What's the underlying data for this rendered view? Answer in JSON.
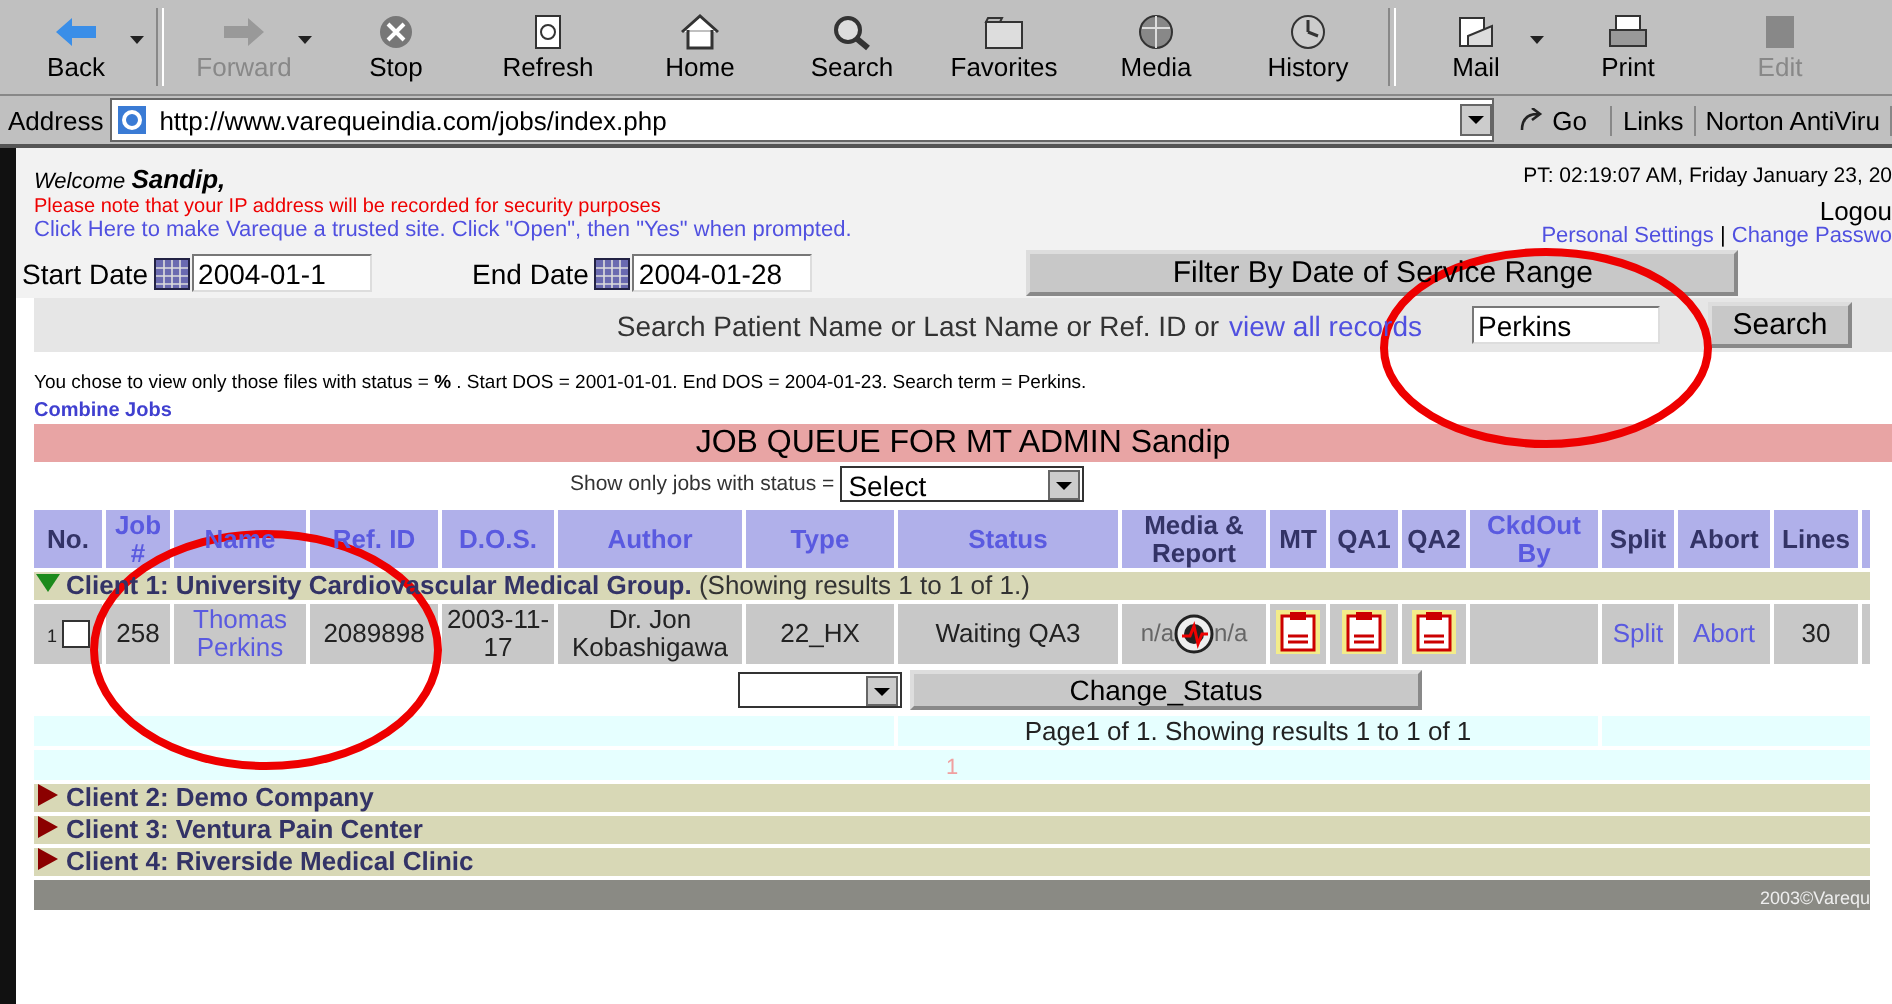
{
  "toolbar": {
    "buttons": [
      {
        "label": "Back",
        "disabled": false,
        "menu": true
      },
      {
        "label": "Forward",
        "disabled": true,
        "menu": true
      },
      {
        "label": "Stop",
        "disabled": false,
        "menu": false
      },
      {
        "label": "Refresh",
        "disabled": false,
        "menu": false
      },
      {
        "label": "Home",
        "disabled": false,
        "menu": false
      },
      {
        "label": "Search",
        "disabled": false,
        "menu": false
      },
      {
        "label": "Favorites",
        "disabled": false,
        "menu": false
      },
      {
        "label": "Media",
        "disabled": false,
        "menu": false
      },
      {
        "label": "History",
        "disabled": false,
        "menu": false
      },
      {
        "label": "Mail",
        "disabled": false,
        "menu": true
      },
      {
        "label": "Print",
        "disabled": false,
        "menu": false
      },
      {
        "label": "Edit",
        "disabled": true,
        "menu": false
      }
    ]
  },
  "address_bar": {
    "label": "Address",
    "url": "http://www.varequeindia.com/jobs/index.php",
    "go": "Go",
    "links": "Links",
    "norton": "Norton AntiViru"
  },
  "header": {
    "welcome": "Welcome",
    "user": "Sandip,",
    "timestamp": "PT: 02:19:07 AM, Friday January 23, 20",
    "notice": "Please note that your IP address will be recorded for security purposes",
    "trusted_link": "Click Here to make Vareque a trusted site. Click \"Open\", then \"Yes\" when prompted.",
    "logout": "Logou",
    "personal_settings": "Personal Settings",
    "separator": "|",
    "change_password": "Change Passwo"
  },
  "filters": {
    "start_label": "Start Date",
    "start_value": "2004-01-1",
    "end_label": "End Date",
    "end_value": "2004-01-28",
    "filter_button": "Filter By Date of Service Range",
    "search_label": "Search Patient Name or Last Name or Ref. ID or",
    "view_all": "view all records",
    "search_value": "Perkins",
    "search_button": "Search"
  },
  "summary": "You chose to view only those files with status = **%** . Start DOS = 2001-01-01. End DOS = 2004-01-23. Search term = Perkins.",
  "combine_jobs": "Combine Jobs",
  "queue": {
    "title": "JOB QUEUE FOR MT ADMIN Sandip",
    "status_filter_label": "Show only jobs with status =",
    "status_filter_value": "Select",
    "columns": [
      {
        "label": "No.",
        "sortable": false
      },
      {
        "label": "Job #",
        "sortable": true
      },
      {
        "label": "Name",
        "sortable": true
      },
      {
        "label": "Ref. ID",
        "sortable": true
      },
      {
        "label": "D.O.S.",
        "sortable": true
      },
      {
        "label": "Author",
        "sortable": true
      },
      {
        "label": "Type",
        "sortable": true
      },
      {
        "label": "Status",
        "sortable": true
      },
      {
        "label": "Media & Report",
        "sortable": false
      },
      {
        "label": "MT",
        "sortable": false
      },
      {
        "label": "QA1",
        "sortable": false
      },
      {
        "label": "QA2",
        "sortable": false
      },
      {
        "label": "CkdOut By",
        "sortable": true
      },
      {
        "label": "Split",
        "sortable": false
      },
      {
        "label": "Abort",
        "sortable": false
      },
      {
        "label": "Lines",
        "sortable": false
      }
    ],
    "groups": [
      {
        "label": "Client 1: University Cardiovascular Medical Group.",
        "note": "(Showing results 1 to 1 of 1.)",
        "expanded": true,
        "rows": [
          {
            "no": "1",
            "checked": false,
            "job": "258",
            "name": "Thomas Perkins",
            "ref_id": "2089898",
            "dos": "2003-11-17",
            "author": "Dr. Jon Kobashigawa",
            "type": "22_HX",
            "status": "Waiting QA3",
            "media_left": "n/a",
            "media_right": "n/a",
            "split": "Split",
            "abort": "Abort",
            "lines": "30"
          }
        ],
        "change_status_button": "Change_Status",
        "pager": "Page1 of 1. Showing results 1 to 1 of 1",
        "page": "1"
      },
      {
        "label": "Client 2: Demo Company",
        "expanded": false
      },
      {
        "label": "Client 3: Ventura Pain Center",
        "expanded": false
      },
      {
        "label": "Client 4: Riverside Medical Clinic",
        "expanded": false
      }
    ]
  },
  "footer": "2003©Varequ"
}
